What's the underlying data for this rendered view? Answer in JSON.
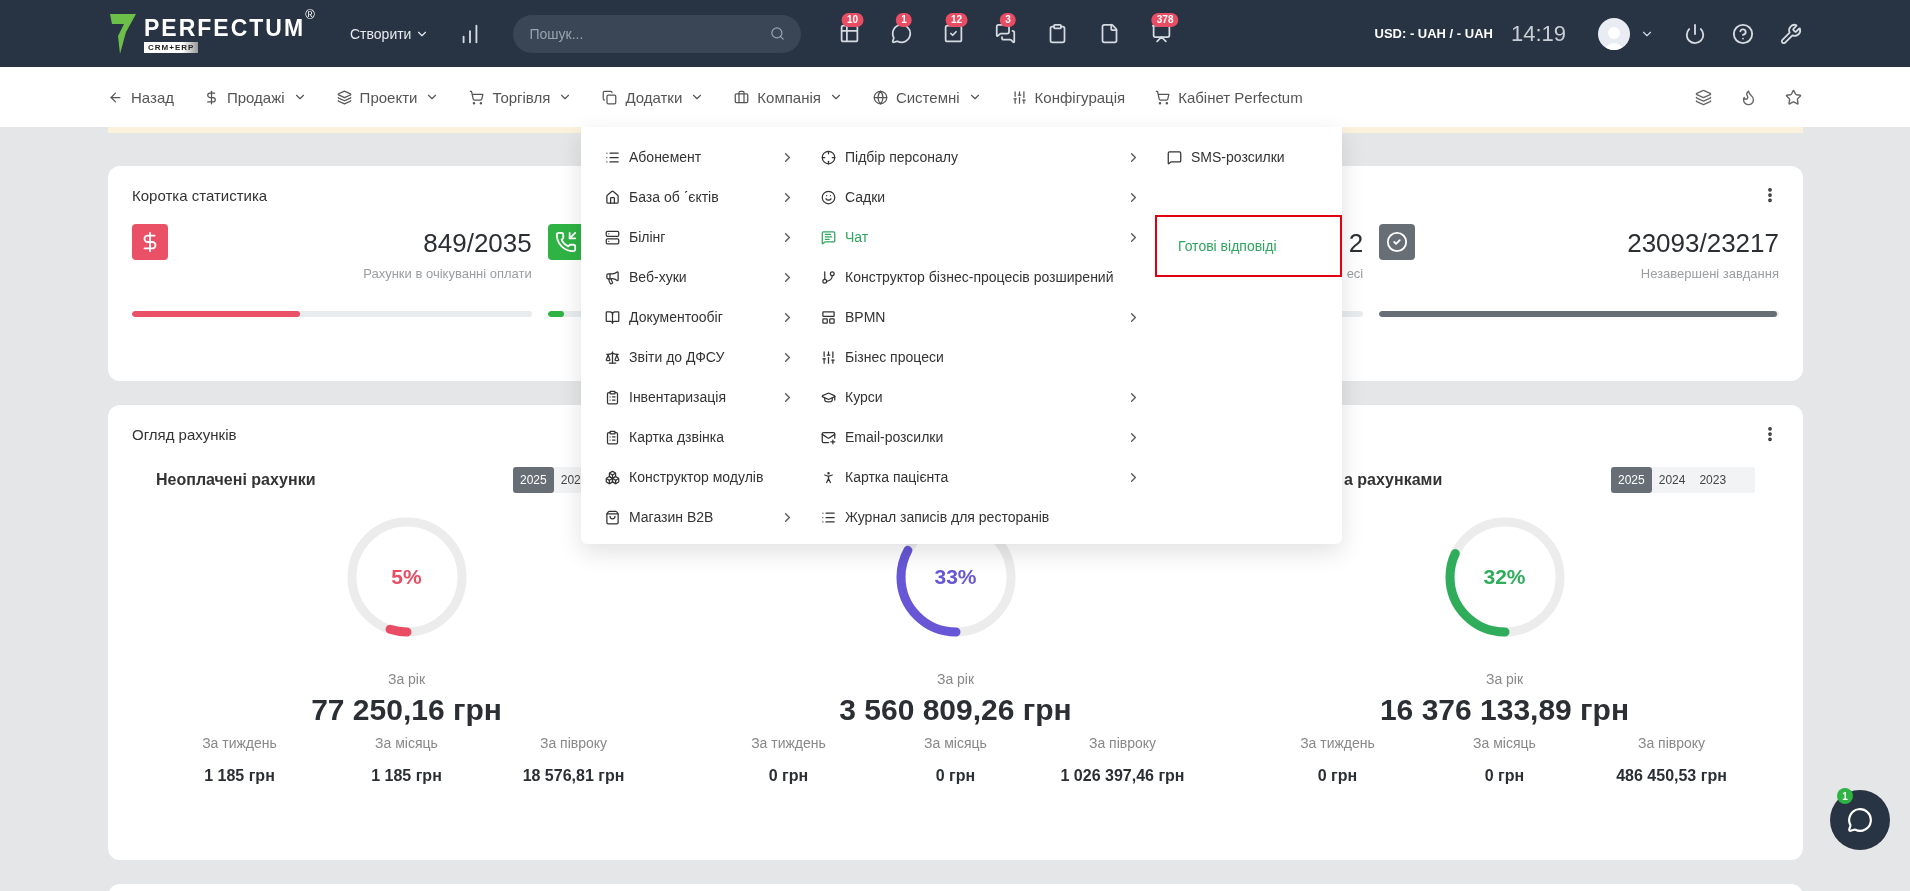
{
  "top_bar": {
    "logo": "PERFECTUM",
    "logo_mark": "®",
    "logo_sub": "CRM+ERP",
    "create_button": "Створити",
    "search": {
      "placeholder": "Пошук..."
    },
    "notifications": [
      {
        "kind": "table",
        "badge": "10"
      },
      {
        "kind": "chat",
        "badge": "1"
      },
      {
        "kind": "tasks",
        "badge": "12"
      },
      {
        "kind": "messages",
        "badge": "3"
      },
      {
        "kind": "clipboard"
      },
      {
        "kind": "document"
      },
      {
        "kind": "board",
        "badge": "378"
      }
    ],
    "currency": "USD: - UAH / - UAH",
    "time": "14:19"
  },
  "nav": {
    "items": [
      {
        "label": "Назад",
        "dropdown": false
      },
      {
        "label": "Продажі",
        "dropdown": true
      },
      {
        "label": "Проекти",
        "dropdown": true
      },
      {
        "label": "Торгівля",
        "dropdown": true
      },
      {
        "label": "Додатки",
        "dropdown": true
      },
      {
        "label": "Компанія",
        "dropdown": true
      },
      {
        "label": "Системні",
        "dropdown": true
      },
      {
        "label": "Конфігурація",
        "dropdown": false
      },
      {
        "label": "Кабінет Perfectum",
        "dropdown": false
      }
    ]
  },
  "menu": {
    "columns": [
      {
        "items": [
          {
            "label": "Абонемент",
            "submenu": true,
            "selected": false
          },
          {
            "label": "База об ˊєктів",
            "submenu": true,
            "selected": false
          },
          {
            "label": "Білінг",
            "submenu": true,
            "selected": false
          },
          {
            "label": "Веб-хуки",
            "submenu": true,
            "selected": false
          },
          {
            "label": "Документообіг",
            "submenu": true,
            "selected": false
          },
          {
            "label": "Звіти до ДФСУ",
            "submenu": true,
            "selected": false
          },
          {
            "label": "Інвентаризація",
            "submenu": true,
            "selected": false
          },
          {
            "label": "Картка дзвінка",
            "submenu": false,
            "selected": false
          },
          {
            "label": "Конструктор модулів",
            "submenu": false,
            "selected": false
          },
          {
            "label": "Магазин B2B",
            "submenu": true,
            "selected": false
          }
        ]
      },
      {
        "items": [
          {
            "label": "Підбір персоналу",
            "submenu": true,
            "selected": false
          },
          {
            "label": "Садки",
            "submenu": true,
            "selected": false
          },
          {
            "label": "Чат",
            "submenu": true,
            "selected": true
          },
          {
            "label": "Конструктор бізнес-процесів розширений",
            "submenu": false,
            "selected": false
          },
          {
            "label": "BPMN",
            "submenu": true,
            "selected": false
          },
          {
            "label": "Бізнес процеси",
            "submenu": false,
            "selected": false
          },
          {
            "label": "Курси",
            "submenu": true,
            "selected": false
          },
          {
            "label": "Email-розсилки",
            "submenu": true,
            "selected": false
          },
          {
            "label": "Картка пацієнта",
            "submenu": true,
            "selected": false
          },
          {
            "label": "Журнал записів для ресторанів",
            "submenu": false,
            "selected": false
          }
        ]
      },
      {
        "items": [
          {
            "label": "SMS-розсилки",
            "submenu": false,
            "selected": false
          }
        ]
      }
    ],
    "submenu": {
      "items": [
        {
          "label": "Готові відповіді",
          "selected": true,
          "highlighted": true
        }
      ]
    }
  },
  "stats_card": {
    "title": "Коротка статистика",
    "stats": [
      {
        "value": "849/2035",
        "label": "Рахунки в очікуванні оплати",
        "level": 0.42,
        "color": "#ea5167"
      },
      {
        "level": 0.04,
        "color": "#2fb344"
      },
      {
        "value": "2",
        "label": "есі"
      },
      {
        "value": "23093/23217",
        "label": "Незавершені завдання",
        "level": 0.995,
        "color": "#676e76"
      }
    ]
  },
  "invoices_card": {
    "title": "Огляд рахунків",
    "columns": [
      {
        "title": "Неоплачені рахунки",
        "years": [
          {
            "label": "2025",
            "selected": true
          },
          {
            "label": "202",
            "selected": false
          }
        ],
        "percent": "5%",
        "level": 0.05,
        "color": "#e94d63",
        "period_label": "За рік",
        "total": "77 250,16 грн",
        "breakdown": [
          {
            "label": "За тиждень",
            "value": "1 185 грн"
          },
          {
            "label": "За місяць",
            "value": "1 185 грн"
          },
          {
            "label": "За півроку",
            "value": "18 576,81 грн"
          }
        ]
      },
      {
        "percent": "33%",
        "level": 0.33,
        "color": "#6756d6",
        "period_label": "За рік",
        "total": "3 560 809,26 грн",
        "breakdown": [
          {
            "label": "За тиждень",
            "value": "0 грн"
          },
          {
            "label": "За місяць",
            "value": "0 грн"
          },
          {
            "label": "За півроку",
            "value": "1 026 397,46 грн"
          }
        ]
      },
      {
        "title": "а рахунками",
        "years": [
          {
            "label": "2025",
            "selected": true
          },
          {
            "label": "2024",
            "selected": false
          },
          {
            "label": "2023",
            "selected": false
          }
        ],
        "percent": "32%",
        "level": 0.32,
        "color": "#2fad5a",
        "period_label": "За рік",
        "total": "16 376 133,89 грн",
        "breakdown": [
          {
            "label": "За тиждень",
            "value": "0 грн"
          },
          {
            "label": "За місяць",
            "value": "0 грн"
          },
          {
            "label": "За півроку",
            "value": "486 450,53 грн"
          }
        ]
      }
    ]
  },
  "chat_button": {
    "badge": "1"
  }
}
